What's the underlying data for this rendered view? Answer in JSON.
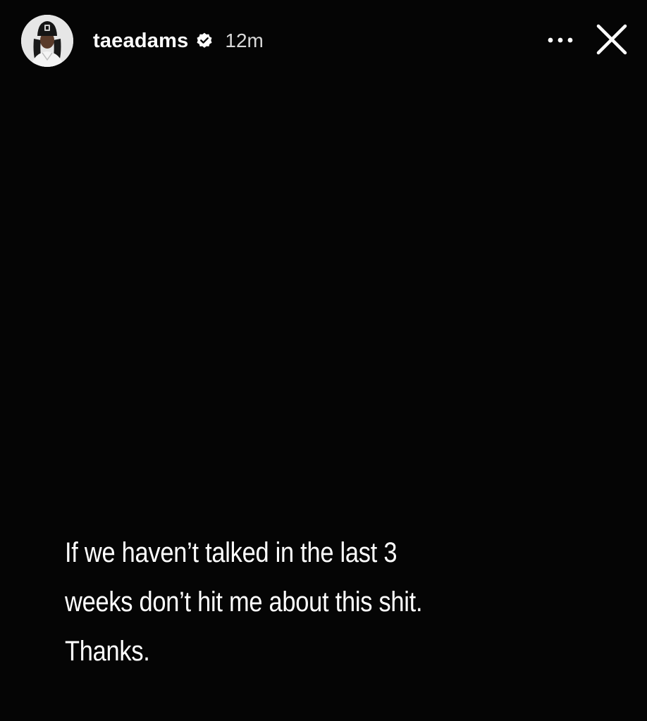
{
  "story": {
    "background": "#050505",
    "header": {
      "username": "taeadams",
      "verified": true,
      "time_ago": "12m",
      "avatar_icon": "profile-avatar",
      "verified_icon": "verified-badge-icon",
      "more_icon": "more-dots-icon",
      "close_icon": "close-icon"
    },
    "caption": {
      "lines": [
        "If we haven’t talked in the last 3",
        "weeks don’t hit me about this shit.",
        "Thanks."
      ]
    }
  }
}
